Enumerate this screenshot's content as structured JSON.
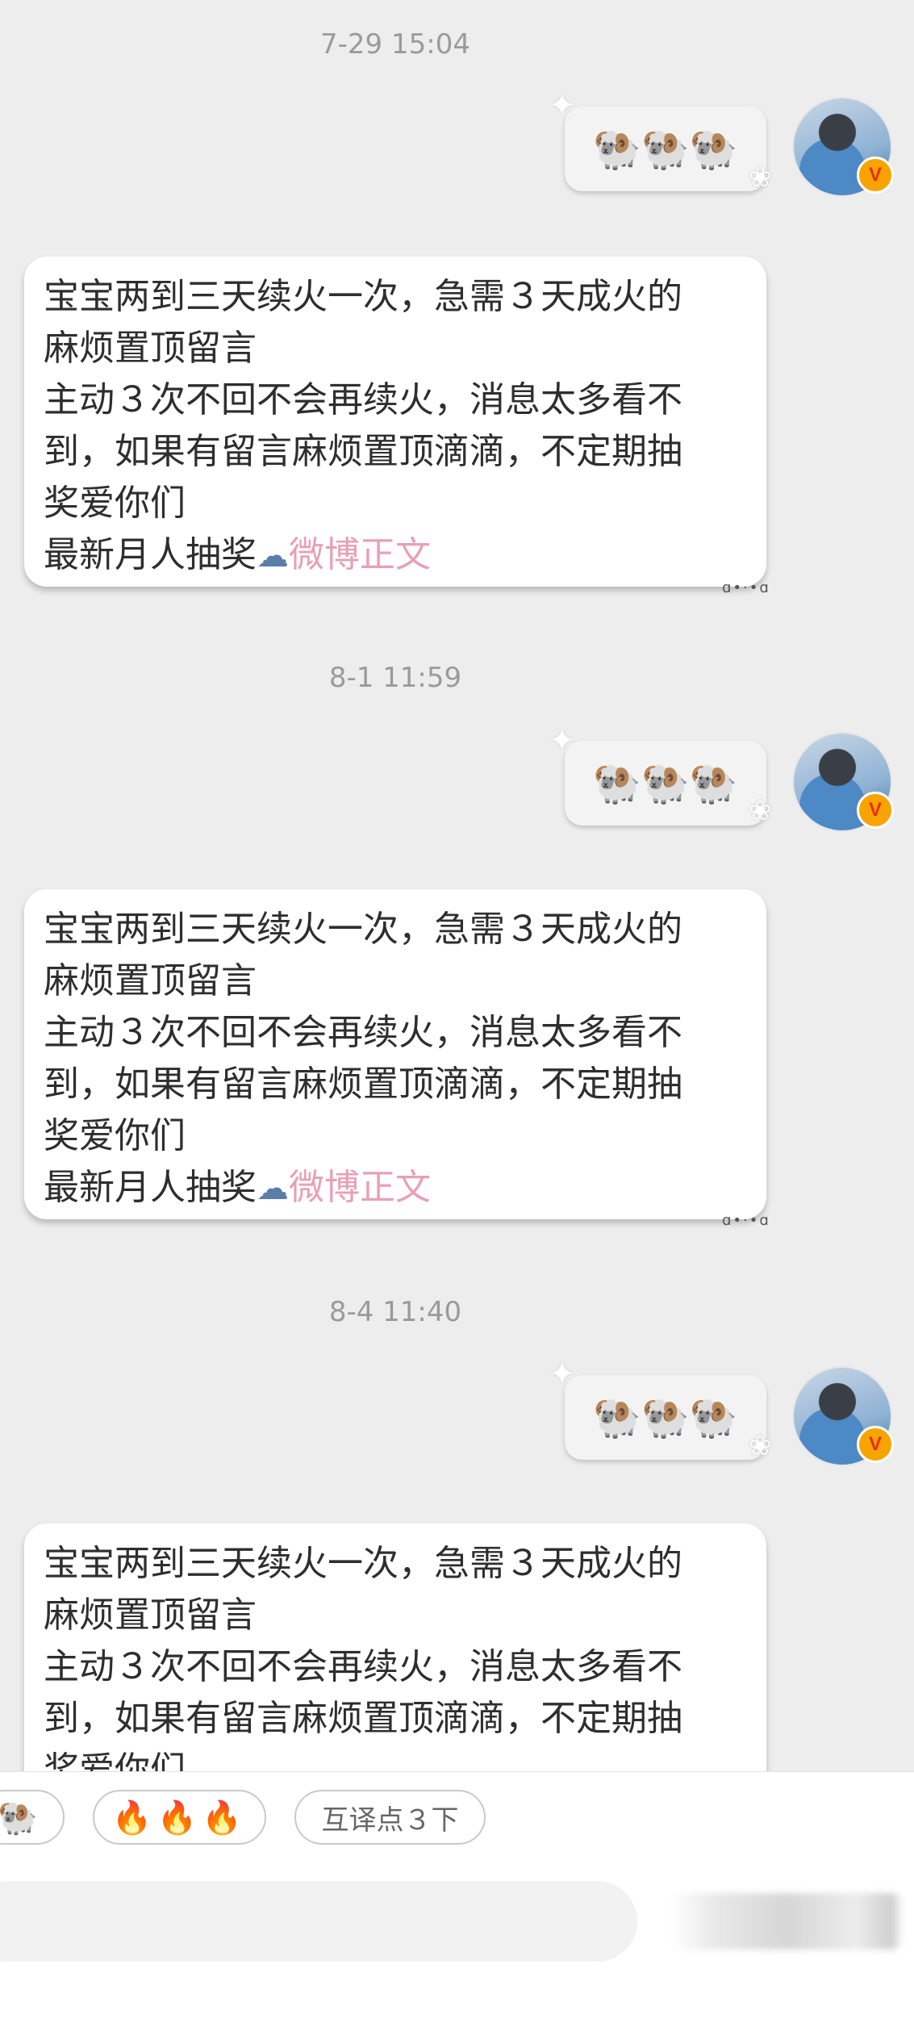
{
  "messages": [
    {
      "timestamp": "7-29 15:04",
      "sent": {
        "emoji": "🐏🐏🐏"
      },
      "received": {
        "lines": [
          "宝宝两到三天续火一次，急需３天成火的",
          "麻烦置顶留言",
          "主动３次不回不会再续火，消息太多看不",
          "到，如果有留言麻烦置顶滴滴，不定期抽",
          "奖爱你们"
        ],
        "link_prefix": "最新月人抽奖",
        "link_icon": "cloud-icon",
        "link_text": "微博正文"
      }
    },
    {
      "timestamp": "8-1 11:59",
      "sent": {
        "emoji": "🐏🐏🐏"
      },
      "received": {
        "lines": [
          "宝宝两到三天续火一次，急需３天成火的",
          "麻烦置顶留言",
          "主动３次不回不会再续火，消息太多看不",
          "到，如果有留言麻烦置顶滴滴，不定期抽",
          "奖爱你们"
        ],
        "link_prefix": "最新月人抽奖",
        "link_icon": "cloud-icon",
        "link_text": "微博正文"
      }
    },
    {
      "timestamp": "8-4 11:40",
      "sent": {
        "emoji": "🐏🐏🐏"
      },
      "received": {
        "lines": [
          "宝宝两到三天续火一次，急需３天成火的",
          "麻烦置顶留言",
          "主动３次不回不会再续火，消息太多看不",
          "到，如果有留言麻烦置顶滴滴，不定期抽",
          "奖爱你们"
        ]
      }
    }
  ],
  "avatar": {
    "badge": "V"
  },
  "quick_replies": [
    {
      "label": "🐏"
    },
    {
      "label": "🔥🔥🔥"
    },
    {
      "label": "互译点３下"
    }
  ],
  "colors": {
    "background": "#ededed",
    "link": "#e8a0b6",
    "badge": "#f7a400"
  }
}
